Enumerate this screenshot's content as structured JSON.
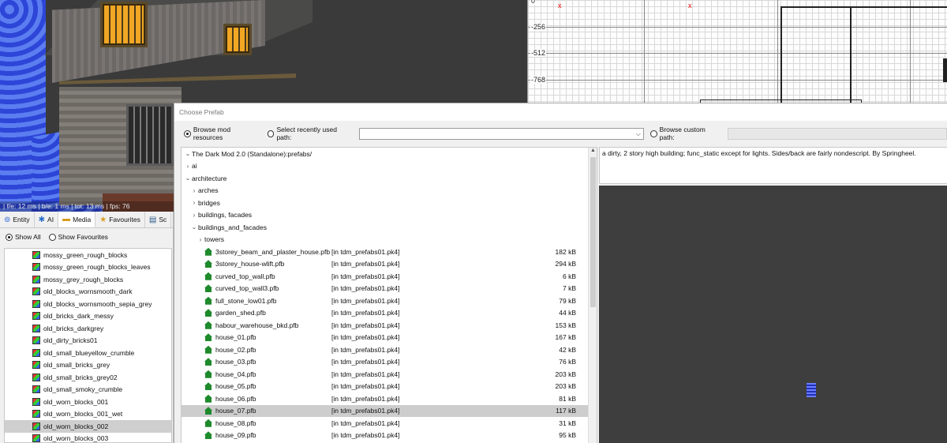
{
  "viewport": {
    "fps_text": "| f/e: 12 ms | b/e: 1 ms | tot: 13 ms | fps: 76"
  },
  "ortho": {
    "coords": [
      "0",
      "-256",
      "-512",
      "-768"
    ],
    "axis_x": "x"
  },
  "left_panel": {
    "tabs": [
      {
        "label": "Entity",
        "icon": "entity-icon"
      },
      {
        "label": "AI",
        "icon": "ai-icon"
      },
      {
        "label": "Media",
        "icon": "folder-icon"
      },
      {
        "label": "Favourites",
        "icon": "star-icon"
      },
      {
        "label": "Sc",
        "icon": "script-icon"
      }
    ],
    "filter": {
      "show_all": "Show All",
      "show_favourites": "Show Favourites",
      "selected": "show_all"
    },
    "items": [
      "mossy_green_rough_blocks",
      "mossy_green_rough_blocks_leaves",
      "mossy_grey_rough_blocks",
      "old_blocks_wornsmooth_dark",
      "old_blocks_wornsmooth_sepia_grey",
      "old_bricks_dark_messy",
      "old_bricks_darkgrey",
      "old_dirty_bricks01",
      "old_small_blueyellow_crumble",
      "old_small_bricks_grey",
      "old_small_bricks_grey02",
      "old_small_smoky_crumble",
      "old_worn_blocks_001",
      "old_worn_blocks_001_wet",
      "old_worn_blocks_002",
      "old_worn_blocks_003"
    ],
    "selected_item": "old_worn_blocks_002"
  },
  "dialog": {
    "title": "Choose Prefab",
    "browse_mod": "Browse mod resources",
    "recent_path": "Select recently used path:",
    "recent_value": "",
    "custom_path": "Browse custom path:",
    "root": "The Dark Mod 2.0 (Standalone):prefabs/",
    "folders": {
      "ai": "ai",
      "architecture": "architecture",
      "arches": "arches",
      "bridges": "bridges",
      "buildings_facades": "buildings, facades",
      "buildings_and_facades": "buildings_and_facades",
      "towers": "towers"
    },
    "files": [
      {
        "name": "3storey_beam_and_plaster_house.pfb",
        "pk": "[in tdm_prefabs01.pk4]",
        "size": "182 kB"
      },
      {
        "name": "3storey_house-wlift.pfb",
        "pk": "[in tdm_prefabs01.pk4]",
        "size": "294 kB"
      },
      {
        "name": "curved_top_wall.pfb",
        "pk": "[in tdm_prefabs01.pk4]",
        "size": "6 kB"
      },
      {
        "name": "curved_top_wall3.pfb",
        "pk": "[in tdm_prefabs01.pk4]",
        "size": "7 kB"
      },
      {
        "name": "full_stone_low01.pfb",
        "pk": "[in tdm_prefabs01.pk4]",
        "size": "79 kB"
      },
      {
        "name": "garden_shed.pfb",
        "pk": "[in tdm_prefabs01.pk4]",
        "size": "44 kB"
      },
      {
        "name": "habour_warehouse_bkd.pfb",
        "pk": "[in tdm_prefabs01.pk4]",
        "size": "153 kB"
      },
      {
        "name": "house_01.pfb",
        "pk": "[in tdm_prefabs01.pk4]",
        "size": "167 kB"
      },
      {
        "name": "house_02.pfb",
        "pk": "[in tdm_prefabs01.pk4]",
        "size": "42 kB"
      },
      {
        "name": "house_03.pfb",
        "pk": "[in tdm_prefabs01.pk4]",
        "size": "76 kB"
      },
      {
        "name": "house_04.pfb",
        "pk": "[in tdm_prefabs01.pk4]",
        "size": "203 kB"
      },
      {
        "name": "house_05.pfb",
        "pk": "[in tdm_prefabs01.pk4]",
        "size": "203 kB"
      },
      {
        "name": "house_06.pfb",
        "pk": "[in tdm_prefabs01.pk4]",
        "size": "81 kB"
      },
      {
        "name": "house_07.pfb",
        "pk": "[in tdm_prefabs01.pk4]",
        "size": "117 kB"
      },
      {
        "name": "house_08.pfb",
        "pk": "[in tdm_prefabs01.pk4]",
        "size": "31 kB"
      },
      {
        "name": "house_09.pfb",
        "pk": "[in tdm_prefabs01.pk4]",
        "size": "95 kB"
      }
    ],
    "selected_file": "house_07.pfb",
    "description": "a dirty, 2 story high building; func_static except for lights.  Sides/back are fairly nondescript. By Springheel."
  }
}
